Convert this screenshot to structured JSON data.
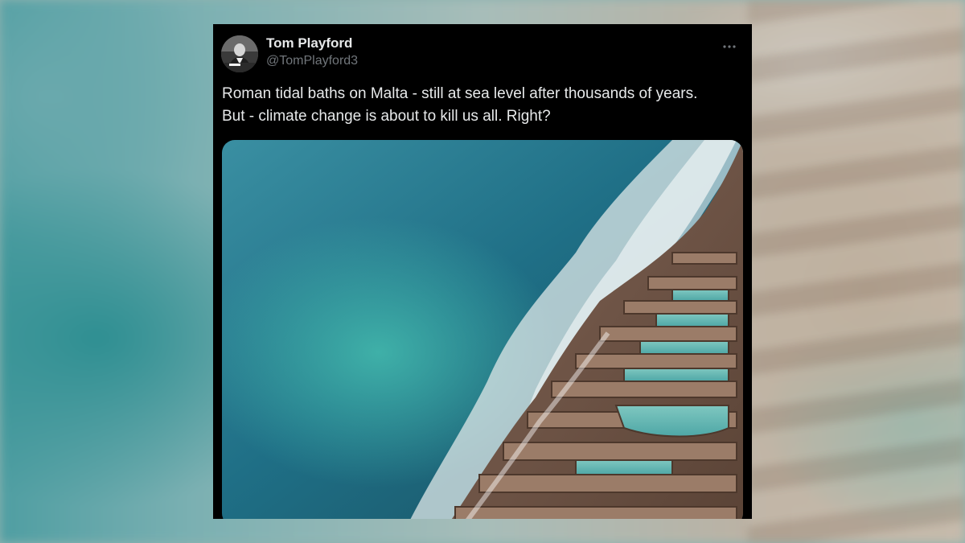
{
  "tweet": {
    "author_name": "Tom Playford",
    "author_handle": "@TomPlayford3",
    "text_lines": [
      "Roman tidal baths on Malta - still at sea level after thousands of years.",
      "But - climate change is about to kill us all. Right?"
    ],
    "icons": {
      "more": "more-horizontal-icon",
      "avatar": "user-avatar"
    },
    "colors": {
      "card_background": "#000000",
      "text_primary": "#e7e9ea",
      "text_secondary": "#71767b"
    }
  }
}
